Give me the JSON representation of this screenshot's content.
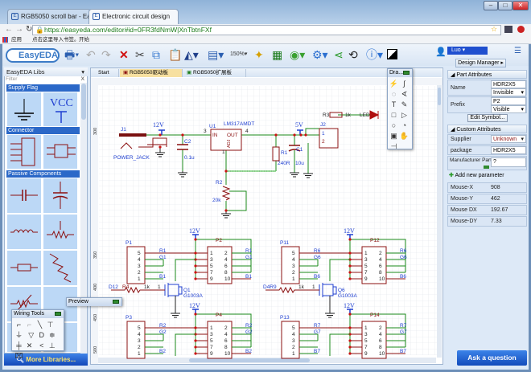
{
  "browser": {
    "tabs": [
      {
        "label": "RGB5050 scroll bar - Ea"
      },
      {
        "label": "Electronic circuit design"
      }
    ],
    "url": "https://easyeda.com/editor#id=0FR3fdNmW|XnTbtnFXf",
    "bookmarks": [
      "应用",
      "点击这里导入书签。",
      "开始"
    ],
    "window_controls": [
      "–",
      "□",
      "✕"
    ]
  },
  "toolbar": {
    "logo": "EasyEDA",
    "zoom": "150%",
    "user": "Luo"
  },
  "library": {
    "title": "EasyEDA Libs",
    "filter_placeholder": "Filter",
    "clear": "X",
    "categories": [
      "Supply Flag",
      "Connector",
      "Passive Components"
    ],
    "vcc": "VCC",
    "more_libraries": "More Libraries..."
  },
  "doc_tabs": [
    "Start",
    "RGB5050驱动板",
    "RGB5050扩展板"
  ],
  "ruler": {
    "top": [
      "500"
    ],
    "left": [
      "300",
      "350",
      "400",
      "450",
      "500"
    ]
  },
  "drawing_tools": {
    "title": "Dra..."
  },
  "wiring_tools": {
    "title": "Wiring Tools"
  },
  "preview": {
    "title": "Preview"
  },
  "right_panel": {
    "design_manager": "Design Manager ▸",
    "part_attributes": "Part Attributes",
    "name_label": "Name",
    "name_value": "HDR2X5",
    "name_visibility": "Invisible",
    "prefix_label": "Prefix",
    "prefix_value": "P2",
    "prefix_visibility": "Visible",
    "edit_symbol": "Edit Symbol...",
    "custom_attributes": "Custom Attributes",
    "supplier_label": "Supplier",
    "supplier_value": "Unknown",
    "package_label": "package",
    "package_value": "HDR2X5",
    "mfr_label": "Manufacturer Part",
    "mfr_value": "?",
    "add_param": "Add new parameter",
    "mouse": [
      {
        "k": "Mouse-X",
        "v": "908"
      },
      {
        "k": "Mouse-Y",
        "v": "462"
      },
      {
        "k": "Mouse DX",
        "v": "192.67"
      },
      {
        "k": "Mouse-DY",
        "v": "7.33"
      }
    ],
    "ask": "Ask a question"
  },
  "schematic": {
    "top": {
      "j1": "J1",
      "power_jack": "POWER_JACK",
      "v12": "12V",
      "c2": "C2",
      "c2v": "0.1u",
      "u1": "U1",
      "u1part": "LM317AMDT",
      "in": "IN",
      "out": "OUT",
      "adj": "ADJ",
      "pin3": "3",
      "pin4": "4",
      "pin1": "1",
      "r1": "R1",
      "r1v": "240R",
      "c1": "C1",
      "c1v": "10u",
      "v5": "5V",
      "j2": "J2",
      "j2p1": "1",
      "j2p2": "2",
      "r3": "R3",
      "r3v": "1k",
      "led": "LED",
      "r2": "R2",
      "r2v": "20k"
    },
    "pins_left": [
      "5",
      "4",
      "3",
      "2",
      "1"
    ],
    "pins_hdr_left": [
      "1",
      "3",
      "5",
      "7",
      "9"
    ],
    "pins_hdr_right": [
      "2",
      "4",
      "6",
      "8",
      "10"
    ],
    "blocks": [
      {
        "left": "P1",
        "right": "P2",
        "nets": [
          "R1",
          "G1",
          "B1"
        ],
        "supply": "12V",
        "q": "Q1",
        "q_part": "G1003A",
        "input": "D12",
        "r_value": "1k",
        "r_ref": "R4",
        "gate": "1"
      },
      {
        "left": "P11",
        "right": "P12",
        "nets": [
          "R6",
          "G6",
          "B6"
        ],
        "supply": "12V",
        "q": "Q6",
        "q_part": "G1003A",
        "input": "D4R9",
        "r_value": "1k",
        "r_ref": "",
        "gate": "1"
      },
      {
        "left": "P3",
        "right": "P4",
        "nets": [
          "R2",
          "G2",
          "B2"
        ],
        "supply": "12V",
        "q": "",
        "q_part": "",
        "input": "",
        "r_value": "",
        "r_ref": "",
        "gate": ""
      },
      {
        "left": "P13",
        "right": "P14",
        "nets": [
          "R7",
          "G7",
          "B7"
        ],
        "supply": "12V",
        "q": "",
        "q_part": "",
        "input": "",
        "r_value": "",
        "r_ref": "",
        "gate": ""
      }
    ]
  },
  "colors": {
    "wire": "#1a8a1a",
    "part": "#8b1010",
    "flag": "#1f3fd0",
    "junction": "#cc1111",
    "accent": "#2b68c8"
  }
}
